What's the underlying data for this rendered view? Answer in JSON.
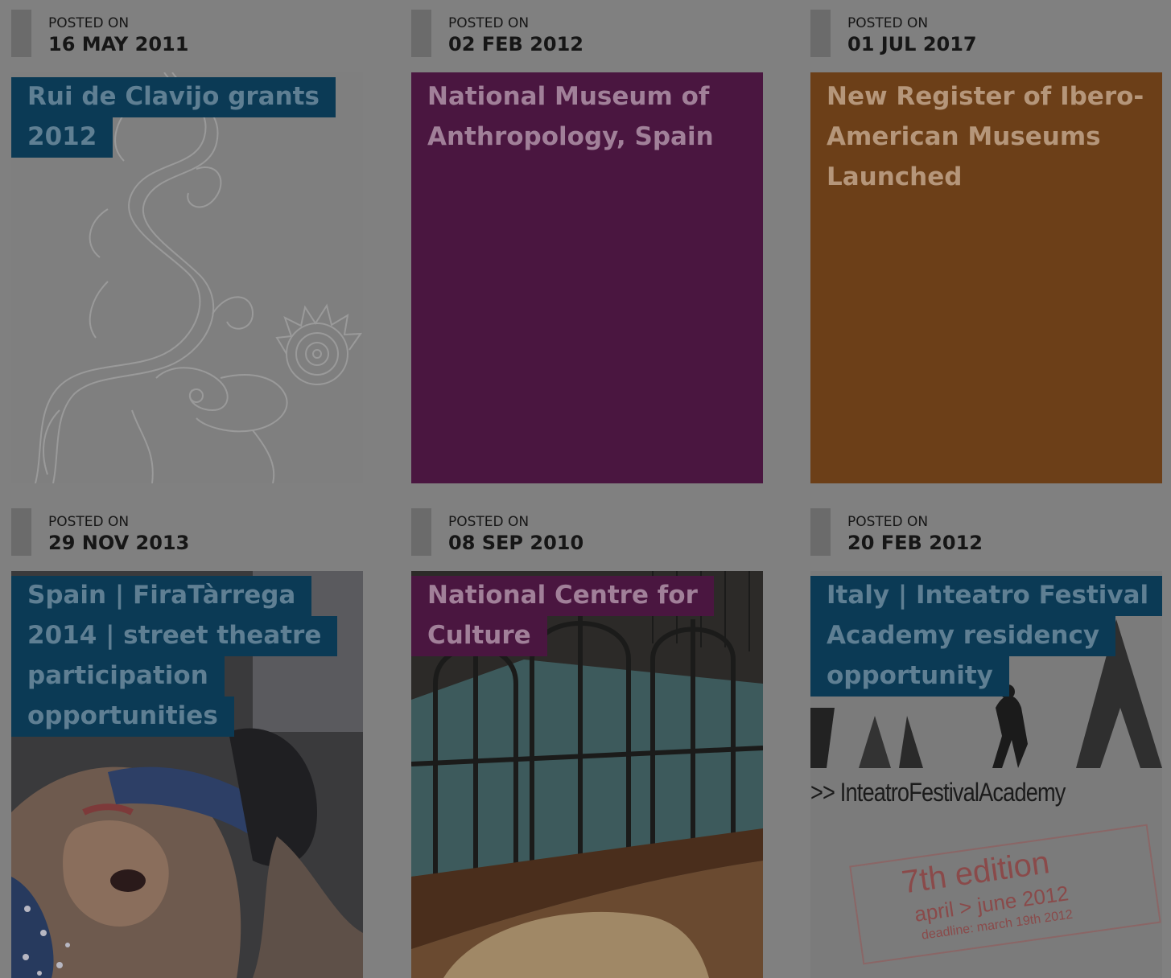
{
  "posted_label": "POSTED ON",
  "colors": {
    "overlay_gray": "#808080",
    "title_blue": "#0b3a55",
    "purple": "#4a1640",
    "orange": "#6c3f18"
  },
  "cards": [
    {
      "date": "16 MAY 2011",
      "title_lines": [
        "Rui de Clavijo grants",
        "2012"
      ],
      "image": "dragon-illustration"
    },
    {
      "date": "02 FEB 2012",
      "title_lines": [
        "National Museum of",
        "Anthropology, Spain"
      ],
      "image": "solid-purple"
    },
    {
      "date": "01 JUL 2017",
      "title_lines": [
        "New Register of Ibero-",
        "American Museums",
        "Launched"
      ],
      "image": "solid-orange"
    },
    {
      "date": "29 NOV 2013",
      "title_lines": [
        "Spain | FiraTàrrega",
        "2014 | street theatre",
        "participation",
        "opportunities"
      ],
      "image": "street-performer-photo"
    },
    {
      "date": "08 SEP 2010",
      "title_lines": [
        "National Centre for",
        "Culture"
      ],
      "image": "building-window-photo"
    },
    {
      "date": "20 FEB 2012",
      "title_lines": [
        "Italy | Inteatro Festival",
        "Academy residency",
        "opportunity"
      ],
      "image": "inteatro-poster",
      "poster": {
        "brand": ">> InteatroFestivalAcademy",
        "edition": "7th edition",
        "dates": "april > june 2012",
        "deadline": "deadline: march 19th 2012"
      }
    }
  ]
}
